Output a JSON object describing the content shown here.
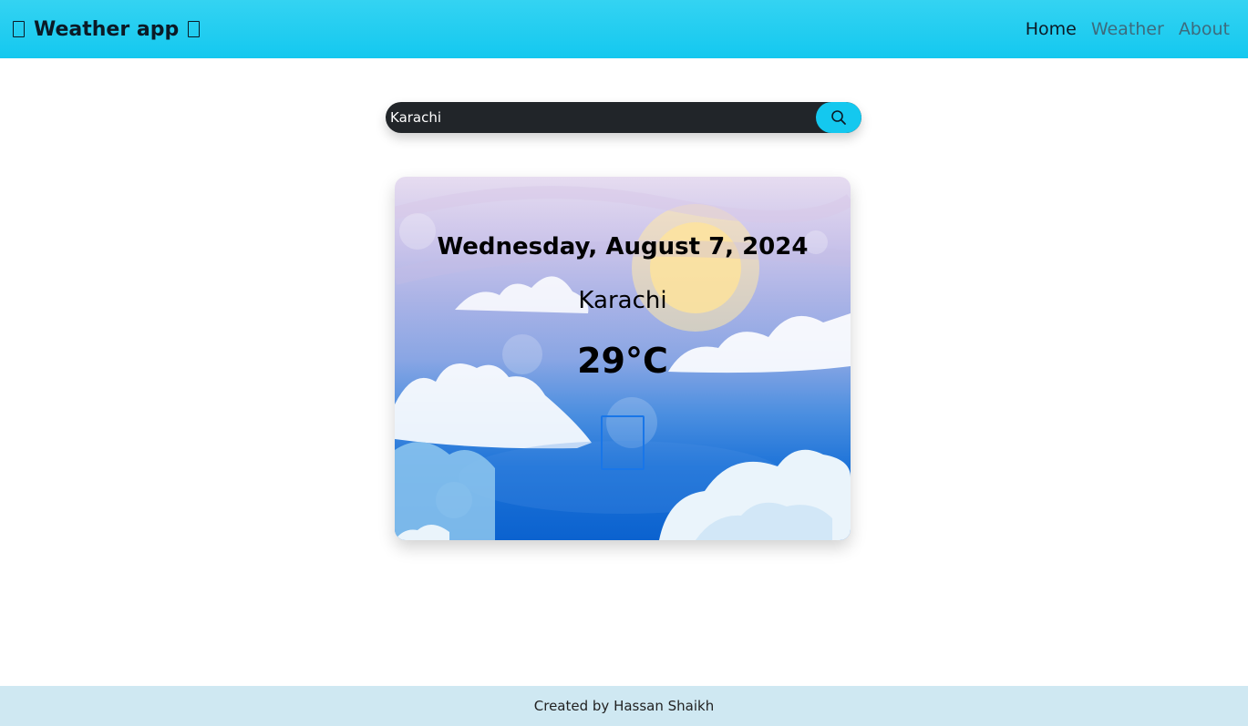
{
  "navbar": {
    "brand_label": "Weather app",
    "links": [
      {
        "label": "Home",
        "active": true
      },
      {
        "label": "Weather",
        "active": false
      },
      {
        "label": "About",
        "active": false
      }
    ]
  },
  "search": {
    "value": "Karachi",
    "button_icon": "search-icon"
  },
  "weather": {
    "date": "Wednesday, August 7, 2024",
    "city": "Karachi",
    "temperature": "29°C",
    "icon": "weather-condition-icon"
  },
  "footer": {
    "text": "Created by Hassan Shaikh"
  },
  "colors": {
    "navbar": "#14c8ef",
    "search_bar": "#212529",
    "search_button": "#14c8ef",
    "footer": "#cfe8f2"
  }
}
